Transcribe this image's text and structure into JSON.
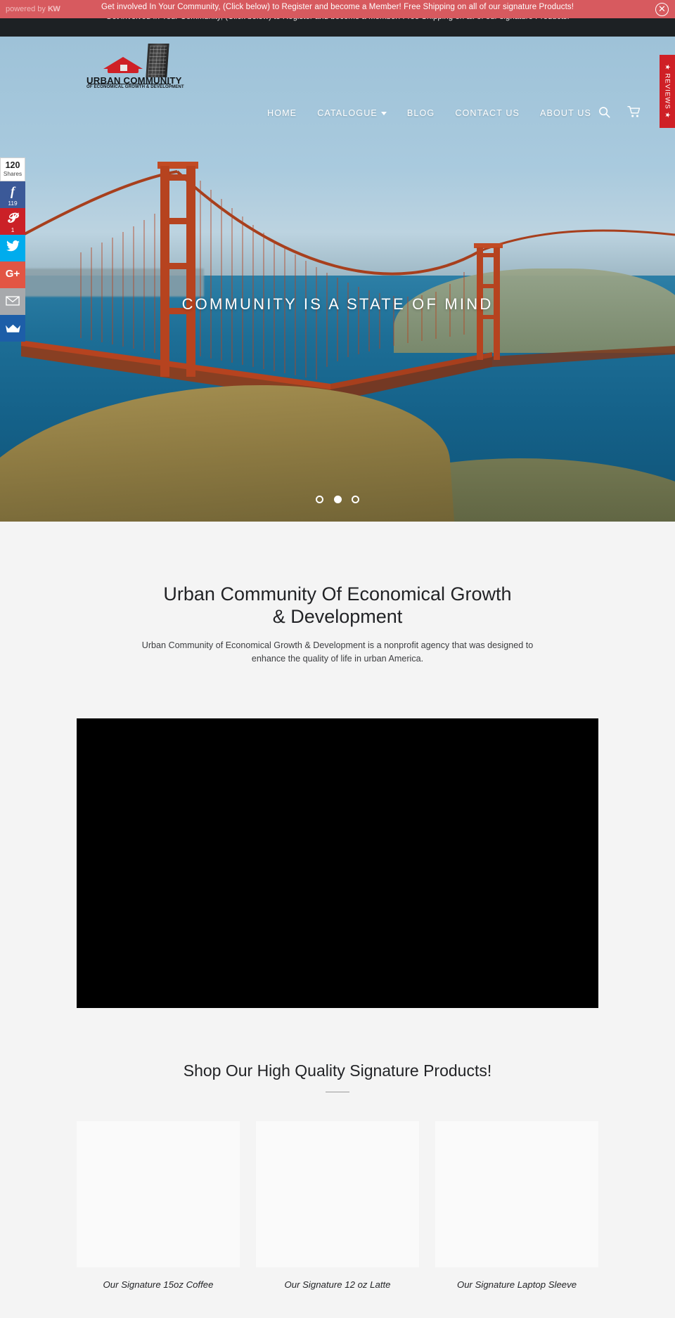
{
  "announcement": {
    "text": "Get involved In Your Community, (Click below) to Register and become a Member! Free Shipping on all of our signature Products!",
    "powered_by_prefix": "powered by",
    "powered_by_brand": "KW",
    "close_icon": "close-circle-icon",
    "bg_color": "#d75a5f"
  },
  "dark_strip": {
    "text": "Get involved In Your Community, (Click below) to Register and become a Member! Free Shipping on all of our signature Products!",
    "bg_color": "#1d2124"
  },
  "header": {
    "logo": {
      "line1": "URBAN COMMUNITY",
      "line2": "OF ECONOMICAL GROWTH & DEVELOPMENT",
      "accent_color": "#cf2026"
    },
    "nav": [
      {
        "label": "HOME",
        "has_caret": false
      },
      {
        "label": "CATALOGUE",
        "has_caret": true
      },
      {
        "label": "BLOG",
        "has_caret": false
      },
      {
        "label": "CONTACT US",
        "has_caret": false
      },
      {
        "label": "ABOUT US",
        "has_caret": false
      }
    ],
    "icons": [
      {
        "name": "search-icon",
        "label": "Search"
      },
      {
        "name": "cart-icon",
        "label": "Cart"
      }
    ]
  },
  "hero": {
    "title": "COMMUNITY IS A STATE OF MIND",
    "slides": 3,
    "active_slide": 2
  },
  "share_rail": {
    "total_count": "120",
    "total_label": "Shares",
    "buttons": [
      {
        "name": "facebook-share-button",
        "glyph": "f",
        "count": "119",
        "color": "#3b5998"
      },
      {
        "name": "pinterest-share-button",
        "glyph": "P",
        "count": "1",
        "color": "#cb2027"
      },
      {
        "name": "twitter-share-button",
        "glyph": "t",
        "count": "",
        "color": "#00aced"
      },
      {
        "name": "google-plus-share-button",
        "glyph": "G+",
        "count": "",
        "color": "#e25544"
      },
      {
        "name": "email-share-button",
        "glyph": "mail",
        "count": "",
        "color": "#a7a9ac"
      },
      {
        "name": "more-share-button",
        "glyph": "crown",
        "count": "",
        "color": "#1d5ea8"
      }
    ]
  },
  "reviews_tab": {
    "label": "REVIEWS",
    "star": "★",
    "color": "#cf2026"
  },
  "intro": {
    "title_line1": "Urban Community Of Economical Growth",
    "title_line2": "& Development",
    "paragraph": "Urban Community of Economical Growth & Development is a nonprofit agency that was designed to enhance the quality of life in urban America.",
    "video_placeholder": "video-player"
  },
  "products": {
    "title": "Shop Our High Quality Signature Products!",
    "items": [
      {
        "name": "Our Signature 15oz Coffee"
      },
      {
        "name": "Our Signature 12 oz Latte"
      },
      {
        "name": "Our Signature Laptop Sleeve"
      }
    ]
  }
}
